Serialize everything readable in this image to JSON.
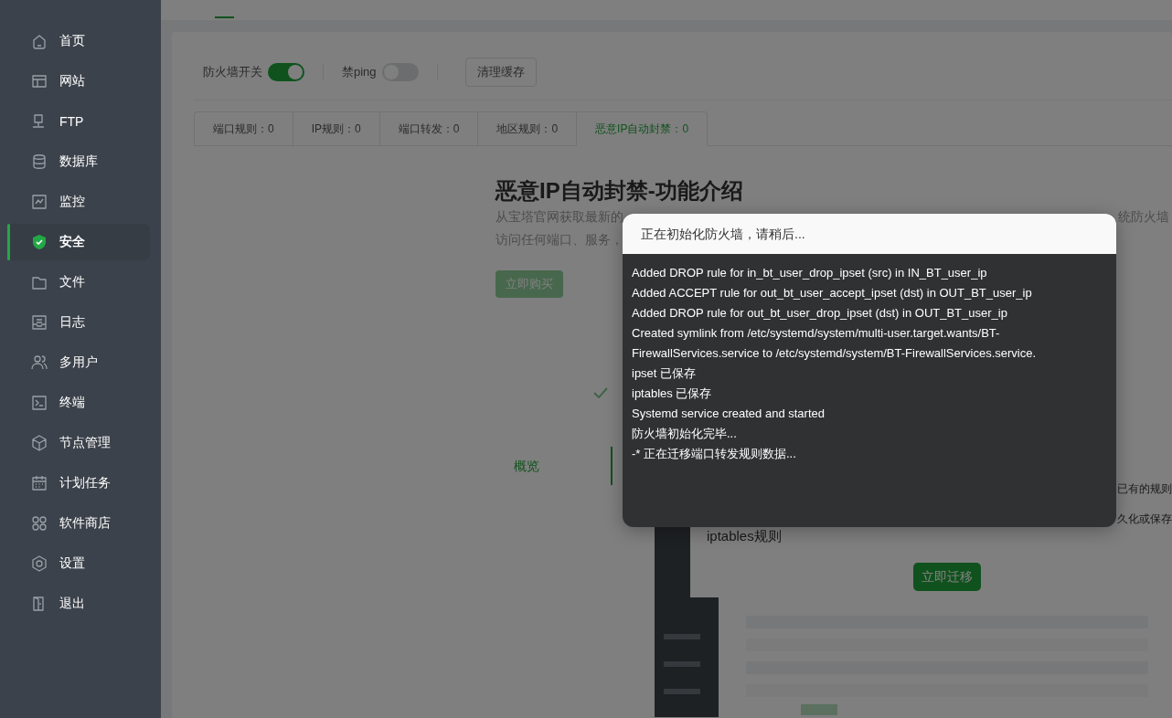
{
  "sidebar": {
    "items": [
      {
        "label": "首页",
        "selected": false
      },
      {
        "label": "网站",
        "selected": false
      },
      {
        "label": "FTP",
        "selected": false
      },
      {
        "label": "数据库",
        "selected": false
      },
      {
        "label": "监控",
        "selected": false
      },
      {
        "label": "安全",
        "selected": true
      },
      {
        "label": "文件",
        "selected": false
      },
      {
        "label": "日志",
        "selected": false
      },
      {
        "label": "多用户",
        "selected": false
      },
      {
        "label": "终端",
        "selected": false
      },
      {
        "label": "节点管理",
        "selected": false
      },
      {
        "label": "计划任务",
        "selected": false
      },
      {
        "label": "软件商店",
        "selected": false
      },
      {
        "label": "设置",
        "selected": false
      },
      {
        "label": "退出",
        "selected": false
      }
    ]
  },
  "toolbar": {
    "switches": [
      {
        "label": "防火墙开关",
        "on": true
      },
      {
        "label": "禁ping",
        "on": false
      }
    ],
    "clear_cache_button": "清理缓存"
  },
  "rule_tabs": [
    {
      "label": "端口规则：0",
      "selected": false
    },
    {
      "label": "IP规则：0",
      "selected": false
    },
    {
      "label": "端口转发：0",
      "selected": false
    },
    {
      "label": "地区规则：0",
      "selected": false
    },
    {
      "label": "恶意IP自动封禁：0",
      "selected": true
    }
  ],
  "intro": {
    "title": "恶意IP自动封禁-功能介绍",
    "line_1_left": "从宝塔官网获取最新的",
    "line_1_right": "统防火墙",
    "line_2_left": "访问任何端口、服务，",
    "buy_button": "立即购买"
  },
  "overview_tab": "概览",
  "migration_panel": {
    "line_1_right": "已有的规则",
    "line_2_right": "久化或保存",
    "line_3": "iptables规则",
    "migrate_button": "立即迁移"
  },
  "dialog": {
    "title": "正在初始化防火墙，请稍后...",
    "log": [
      "Added DROP rule for in_bt_user_drop_ipset (src) in IN_BT_user_ip",
      "Added ACCEPT rule for out_bt_user_accept_ipset (dst) in OUT_BT_user_ip",
      "Added DROP rule for out_bt_user_drop_ipset (dst) in OUT_BT_user_ip",
      "Created symlink from /etc/systemd/system/multi-user.target.wants/BT-",
      "FirewallServices.service to /etc/systemd/system/BT-FirewallServices.service.",
      "ipset 已保存",
      "iptables 已保存",
      "Systemd service created and started",
      "防火墙初始化完毕...",
      "-* 正在迁移端口转发规则数据..."
    ]
  }
}
